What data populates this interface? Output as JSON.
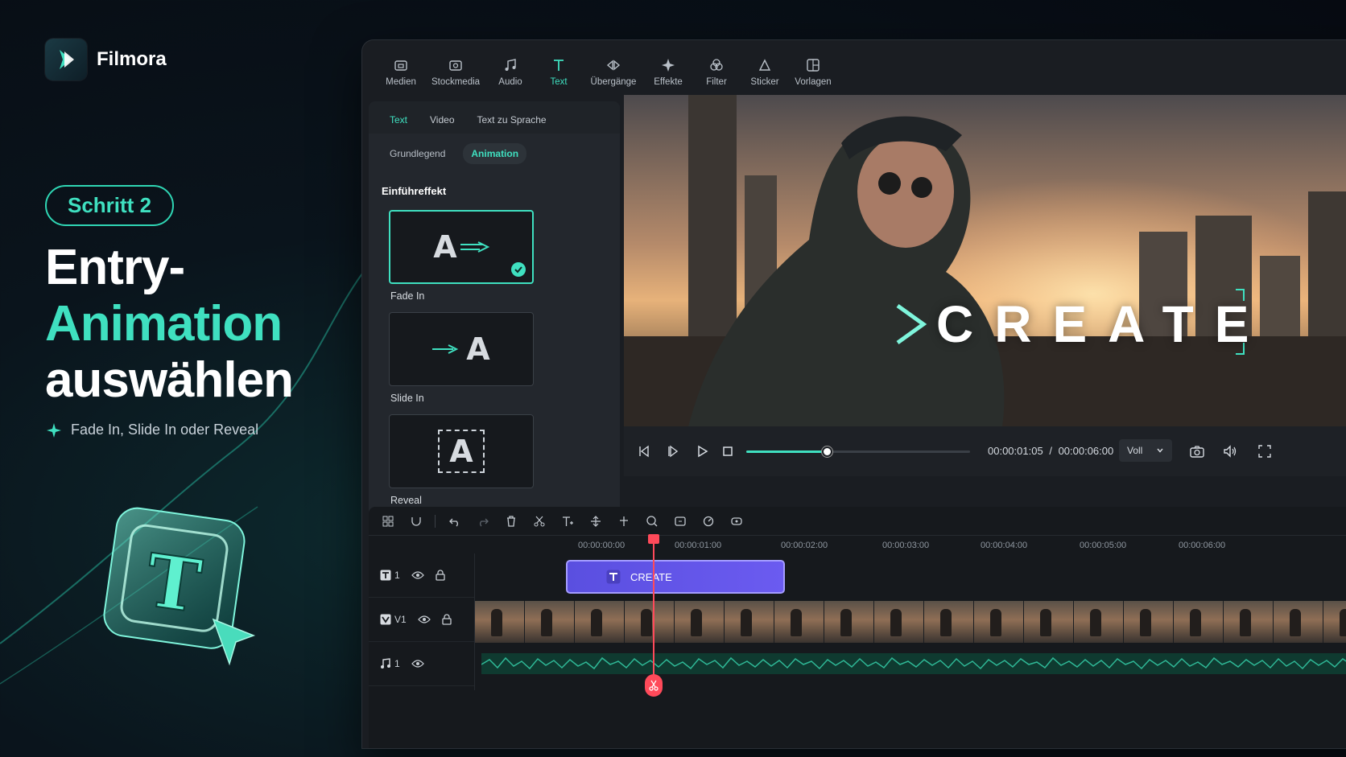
{
  "brand": {
    "name": "Filmora",
    "accent": "#3fe0c0"
  },
  "hero": {
    "step": "Schritt 2",
    "headline_line1": "Entry-",
    "headline_line2": "Animation",
    "headline_line3": "auswählen",
    "subtitle": "Fade In, Slide In oder Reveal"
  },
  "toolbar": {
    "items": [
      {
        "label": "Medien",
        "icon": "folder-icon"
      },
      {
        "label": "Stockmedia",
        "icon": "stock-media-icon"
      },
      {
        "label": "Audio",
        "icon": "music-note-icon"
      },
      {
        "label": "Text",
        "icon": "text-icon",
        "active": true
      },
      {
        "label": "Übergänge",
        "icon": "transitions-icon"
      },
      {
        "label": "Effekte",
        "icon": "effects-icon"
      },
      {
        "label": "Filter",
        "icon": "filter-icon"
      },
      {
        "label": "Sticker",
        "icon": "sticker-icon"
      },
      {
        "label": "Vorlagen",
        "icon": "templates-icon"
      }
    ]
  },
  "panel": {
    "tabs": [
      "Text",
      "Video",
      "Text zu Sprache"
    ],
    "subtabs": [
      "Grundlegend",
      "Animation"
    ],
    "section_title": "Einführeffekt",
    "effects": [
      {
        "label": "Fade In",
        "selected": true
      },
      {
        "label": "Slide In",
        "selected": false
      },
      {
        "label": "Reveal",
        "selected": false
      }
    ],
    "effect_glyph": "A"
  },
  "preview": {
    "overlay_text": "CREATE"
  },
  "player": {
    "current_time": "00:00:01:05",
    "separator": "/",
    "total_time": "00:00:06:00",
    "quality": "Voll",
    "progress": 0.36
  },
  "timeline": {
    "ruler": [
      "00:00:00:00",
      "00:00:01:00",
      "00:00:02:00",
      "00:00:03:00",
      "00:00:04:00",
      "00:00:05:00",
      "00:00:06:00"
    ],
    "tracks": [
      {
        "label": "1",
        "type": "text"
      },
      {
        "label": "V1",
        "type": "video"
      },
      {
        "label": "1",
        "type": "audio"
      }
    ],
    "text_clip": "CREATE"
  }
}
